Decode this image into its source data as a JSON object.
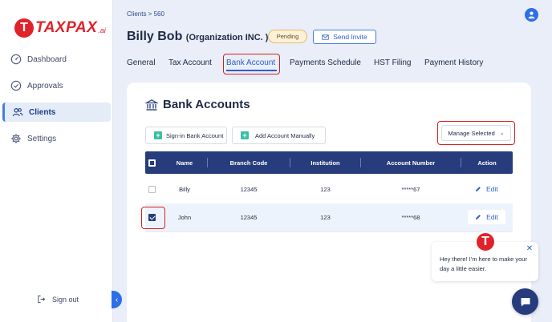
{
  "brand": {
    "mark": "T",
    "name": "TAXPAX",
    "suffix": ".ai",
    "color": "#e0222b"
  },
  "sidebar": {
    "items": [
      {
        "label": "Dashboard",
        "icon": "dashboard-gauge-icon",
        "active": false
      },
      {
        "label": "Approvals",
        "icon": "check-circle-icon",
        "active": false
      },
      {
        "label": "Clients",
        "icon": "users-icon",
        "active": true
      },
      {
        "label": "Settings",
        "icon": "gear-icon",
        "active": false
      }
    ],
    "signout_label": "Sign out"
  },
  "header": {
    "breadcrumb": "Clients > 560",
    "client_name": "Billy Bob",
    "org_name": "(Organization INC. )",
    "status_badge": "Pending",
    "invite_label": "Send Invite"
  },
  "tabs": [
    {
      "label": "General",
      "active": false
    },
    {
      "label": "Tax Account",
      "active": false
    },
    {
      "label": "Bank Account",
      "active": true
    },
    {
      "label": "Payments Schedule",
      "active": false
    },
    {
      "label": "HST Filing",
      "active": false
    },
    {
      "label": "Payment History",
      "active": false
    }
  ],
  "bank": {
    "title": "Bank Accounts",
    "signin_label": "Sign-in Bank Account",
    "manual_label": "Add Account Manually",
    "manage_label": "Manage Selected",
    "columns": [
      "Name",
      "Branch Code",
      "Institution",
      "Account Number",
      "Action"
    ],
    "rows": [
      {
        "checked": false,
        "name": "Billy",
        "branch": "12345",
        "institution": "123",
        "account": "*****67",
        "action": "Edit"
      },
      {
        "checked": true,
        "name": "John",
        "branch": "12345",
        "institution": "123",
        "account": "*****68",
        "action": "Edit"
      }
    ]
  },
  "chat": {
    "avatar_mark": "T",
    "message": "Hey there! I'm here to make your day a little easier."
  },
  "colors": {
    "accent": "#2d6fe8",
    "table_header": "#263c7c",
    "highlight": "#d8201e",
    "plus": "#3cbfa4"
  }
}
